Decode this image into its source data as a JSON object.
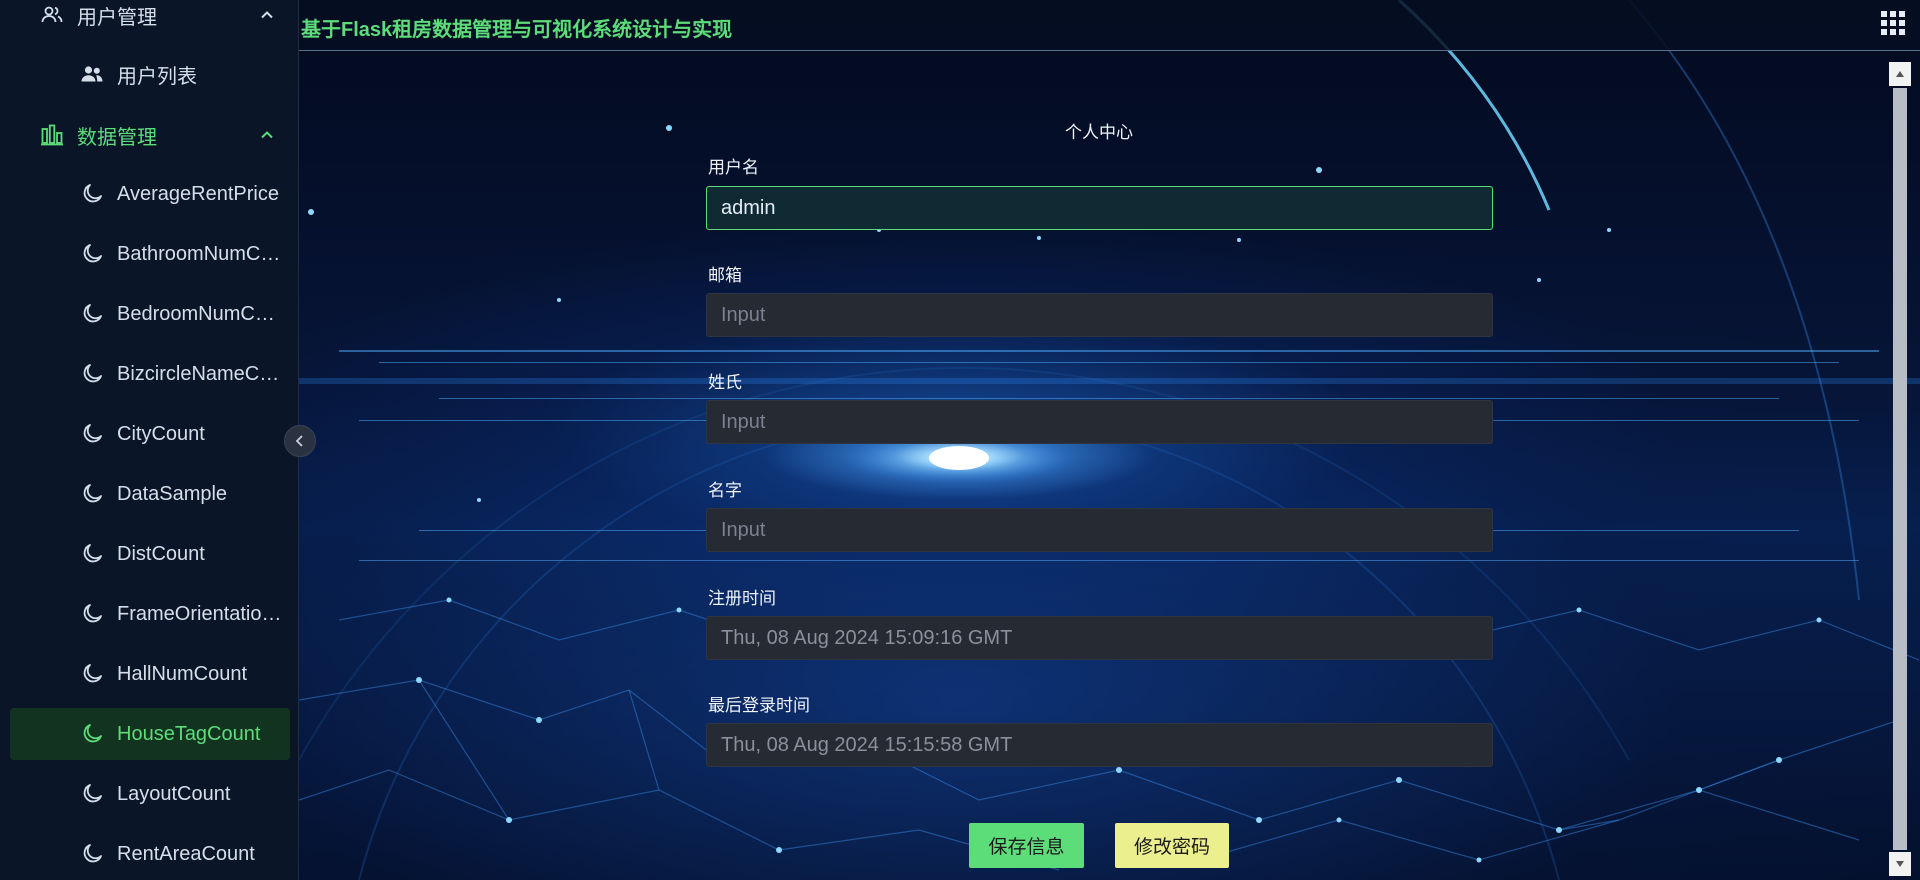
{
  "app": {
    "title": "基于Flask租房数据管理与可视化系统设计与实现"
  },
  "sidebar": {
    "groups": [
      {
        "label": "用户管理",
        "icon": "user-group-icon",
        "expanded": true
      },
      {
        "label": "数据管理",
        "icon": "bar-chart-icon",
        "expanded": true
      }
    ],
    "user_items": [
      {
        "label": "用户列表",
        "icon": "users-icon"
      }
    ],
    "data_items": [
      {
        "label": "AverageRentPrice",
        "icon": "moon-icon"
      },
      {
        "label": "BathroomNumCount",
        "icon": "moon-icon"
      },
      {
        "label": "BedroomNumCount",
        "icon": "moon-icon"
      },
      {
        "label": "BizcircleNameCount",
        "icon": "moon-icon"
      },
      {
        "label": "CityCount",
        "icon": "moon-icon"
      },
      {
        "label": "DataSample",
        "icon": "moon-icon"
      },
      {
        "label": "DistCount",
        "icon": "moon-icon"
      },
      {
        "label": "FrameOrientationCount",
        "icon": "moon-icon"
      },
      {
        "label": "HallNumCount",
        "icon": "moon-icon"
      },
      {
        "label": "HouseTagCount",
        "icon": "moon-icon",
        "active": true
      },
      {
        "label": "LayoutCount",
        "icon": "moon-icon"
      },
      {
        "label": "RentAreaCount",
        "icon": "moon-icon"
      }
    ]
  },
  "profile": {
    "heading": "个人中心",
    "fields": [
      {
        "label": "用户名",
        "value": "admin",
        "placeholder": ""
      },
      {
        "label": "邮箱",
        "value": "",
        "placeholder": "Input"
      },
      {
        "label": "姓氏",
        "value": "",
        "placeholder": "Input"
      },
      {
        "label": "名字",
        "value": "",
        "placeholder": "Input"
      },
      {
        "label": "注册时间",
        "value": "Thu, 08 Aug 2024 15:09:16 GMT",
        "placeholder": ""
      },
      {
        "label": "最后登录时间",
        "value": "Thu, 08 Aug 2024 15:15:58 GMT",
        "placeholder": ""
      }
    ],
    "save_label": "保存信息",
    "change_password_label": "修改密码"
  },
  "colors": {
    "accent": "#5ddc7a",
    "sidebar_bg": "#0a1628",
    "input_bg": "#262a33",
    "change_password_bg": "#ecef8d"
  }
}
